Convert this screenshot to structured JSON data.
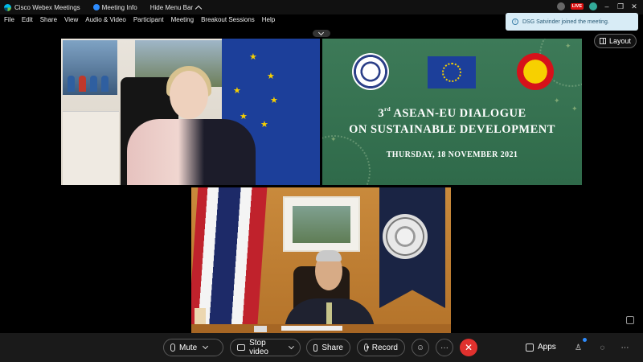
{
  "window": {
    "app_title": "Cisco Webex Meetings",
    "meeting_info": "Meeting Info",
    "hide_menu": "Hide Menu Bar",
    "live_badge": "LIVE"
  },
  "menu": [
    "File",
    "Edit",
    "Share",
    "View",
    "Audio & Video",
    "Participant",
    "Meeting",
    "Breakout Sessions",
    "Help"
  ],
  "notification": {
    "text": "DSG Satvinder joined the meeting."
  },
  "layout_button": {
    "label": "Layout"
  },
  "slide": {
    "ordinal": "3",
    "ordinal_suffix": "rd",
    "title_line1": "ASEAN-EU DIALOGUE",
    "title_line2": "ON SUSTAINABLE DEVELOPMENT",
    "date": "THURSDAY, 18 NOVEMBER 2021"
  },
  "controls": {
    "mute": "Mute",
    "stop_video": "Stop video",
    "share": "Share",
    "record": "Record",
    "more": "···",
    "leave": "✕",
    "apps": "Apps"
  },
  "colors": {
    "slide_green": "#3d7a58",
    "eu_blue": "#1c3f9a",
    "leave_red": "#e0312e",
    "toast_bg": "#d8ecf6"
  },
  "icons": [
    "webex-logo-icon",
    "meeting-info-icon",
    "chevron-up-icon",
    "layout-grid-icon",
    "info-icon",
    "microphone-icon",
    "camera-icon",
    "share-screen-icon",
    "record-icon",
    "reactions-icon",
    "more-icon",
    "close-icon",
    "apps-icon",
    "participants-icon",
    "chat-icon",
    "more-options-icon",
    "expand-icon"
  ]
}
